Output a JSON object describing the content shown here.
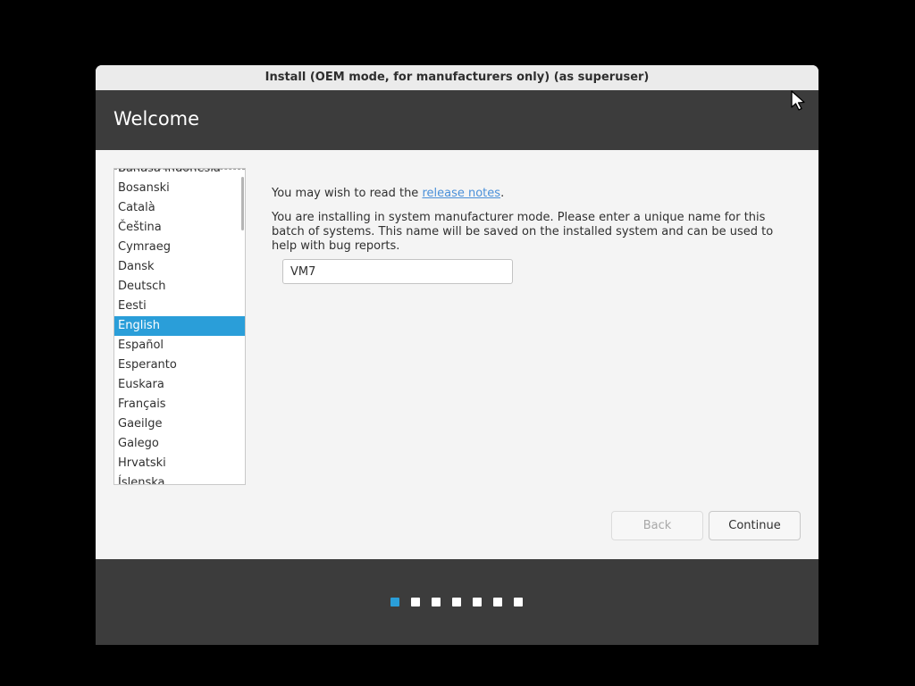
{
  "window": {
    "title": "Install (OEM mode, for manufacturers only) (as superuser)"
  },
  "header": {
    "title": "Welcome"
  },
  "languages": {
    "items": [
      {
        "label": "Bahasa Indonesia",
        "selected": false
      },
      {
        "label": "Bosanski",
        "selected": false
      },
      {
        "label": "Català",
        "selected": false
      },
      {
        "label": "Čeština",
        "selected": false
      },
      {
        "label": "Cymraeg",
        "selected": false
      },
      {
        "label": "Dansk",
        "selected": false
      },
      {
        "label": "Deutsch",
        "selected": false
      },
      {
        "label": "Eesti",
        "selected": false
      },
      {
        "label": "English",
        "selected": true
      },
      {
        "label": "Español",
        "selected": false
      },
      {
        "label": "Esperanto",
        "selected": false
      },
      {
        "label": "Euskara",
        "selected": false
      },
      {
        "label": "Français",
        "selected": false
      },
      {
        "label": "Gaeilge",
        "selected": false
      },
      {
        "label": "Galego",
        "selected": false
      },
      {
        "label": "Hrvatski",
        "selected": false
      },
      {
        "label": "Íslenska",
        "selected": false
      }
    ]
  },
  "main": {
    "notes_prefix": "You may wish to read the ",
    "notes_link": "release notes",
    "notes_suffix": ".",
    "oem_text": "You are installing in system manufacturer mode. Please enter a unique name for this batch of systems. This name will be saved on the installed system and can be used to help with bug reports.",
    "batch_name_value": "VM7"
  },
  "buttons": {
    "back": "Back",
    "continue": "Continue"
  },
  "progress": {
    "total_steps": 7,
    "current_step": 1
  },
  "colors": {
    "accent": "#2a9ed9",
    "header_bg": "#3c3c3c",
    "link": "#4a90d9"
  }
}
